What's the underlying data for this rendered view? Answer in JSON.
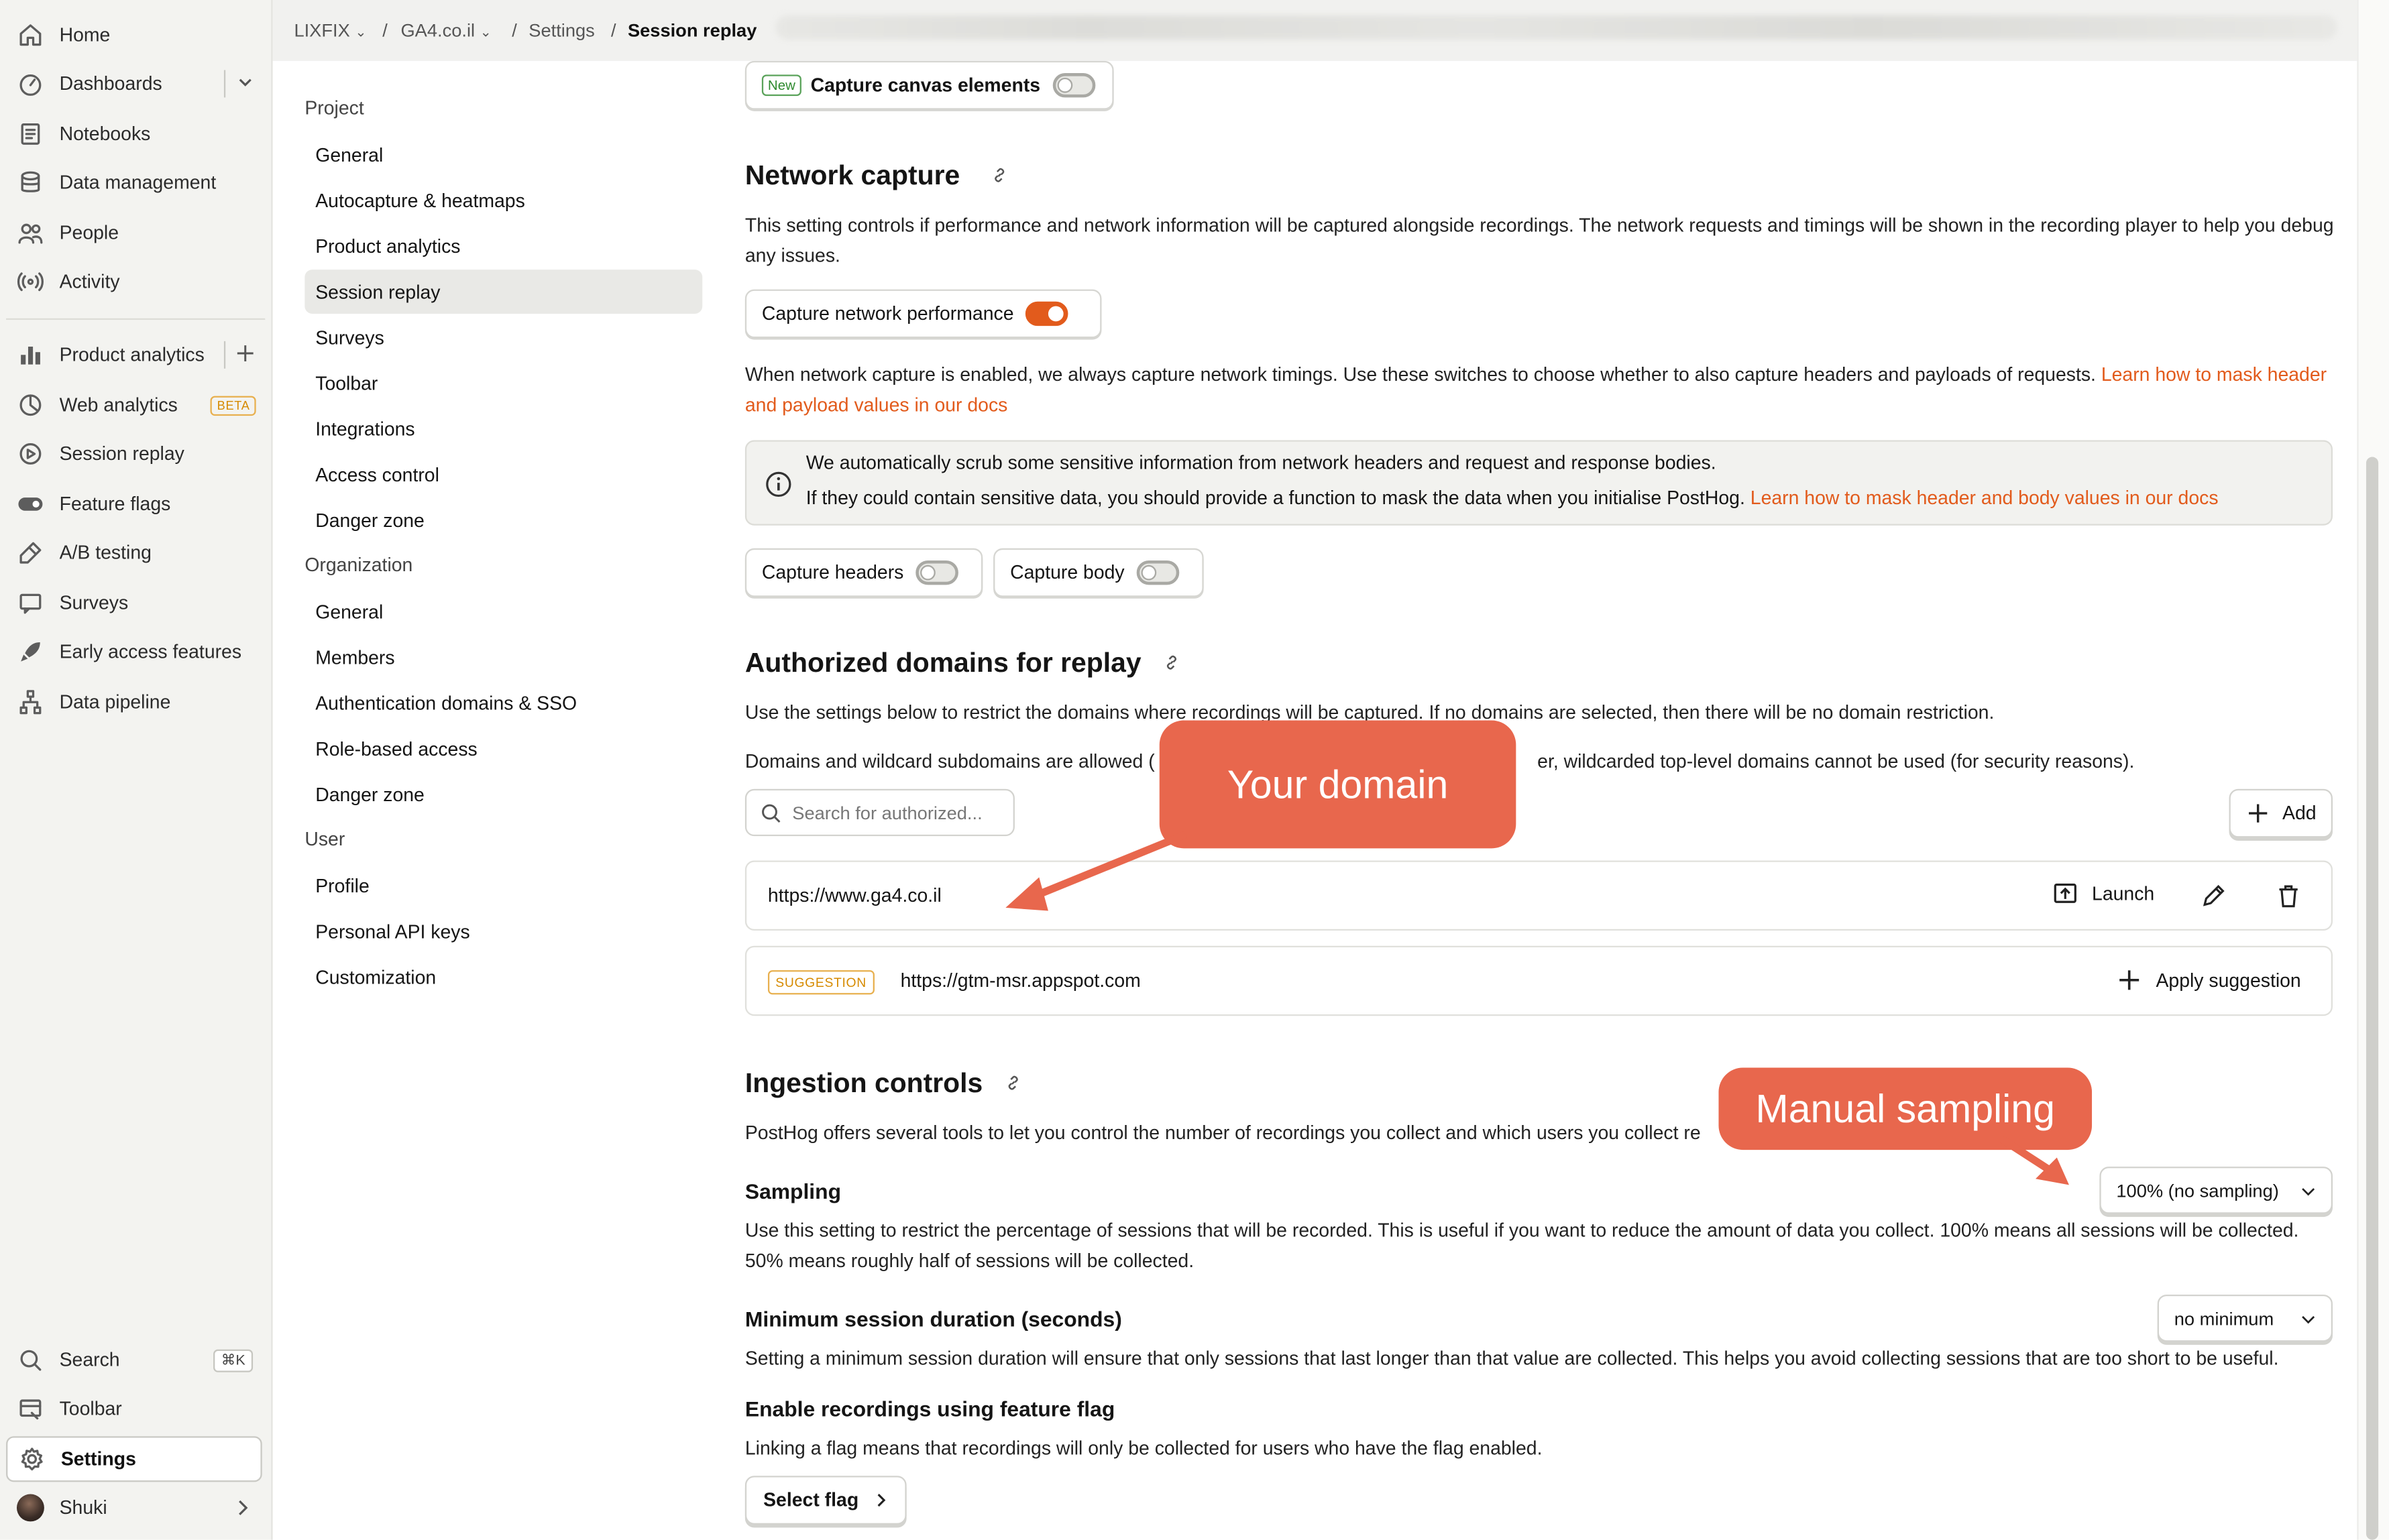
{
  "leftnav": {
    "items": [
      {
        "label": "Home",
        "icon": "home-icon"
      },
      {
        "label": "Dashboards",
        "icon": "dashboard-icon"
      },
      {
        "label": "Notebooks",
        "icon": "notebook-icon"
      },
      {
        "label": "Data management",
        "icon": "database-icon"
      },
      {
        "label": "People",
        "icon": "people-icon"
      },
      {
        "label": "Activity",
        "icon": "activity-icon"
      },
      {
        "label": "Product analytics",
        "icon": "bar-chart-icon"
      },
      {
        "label": "Web analytics",
        "icon": "web-analytics-icon",
        "badge": "BETA"
      },
      {
        "label": "Session replay",
        "icon": "play-icon"
      },
      {
        "label": "Feature flags",
        "icon": "toggle-icon"
      },
      {
        "label": "A/B testing",
        "icon": "flask-icon"
      },
      {
        "label": "Surveys",
        "icon": "survey-icon"
      },
      {
        "label": "Early access features",
        "icon": "rocket-icon"
      },
      {
        "label": "Data pipeline",
        "icon": "pipeline-icon"
      }
    ],
    "bottom": {
      "search": {
        "label": "Search",
        "shortcut": "⌘K"
      },
      "toolbar": {
        "label": "Toolbar"
      },
      "settings": {
        "label": "Settings"
      },
      "user": {
        "label": "Shuki"
      }
    }
  },
  "breadcrumb": {
    "org": "LIXFIX",
    "project": "GA4.co.il",
    "section": "Settings",
    "current": "Session replay"
  },
  "settings_nav": {
    "project_heading": "Project",
    "project_items": [
      "General",
      "Autocapture & heatmaps",
      "Product analytics",
      "Session replay",
      "Surveys",
      "Toolbar",
      "Integrations",
      "Access control",
      "Danger zone"
    ],
    "organization_heading": "Organization",
    "organization_items": [
      "General",
      "Members",
      "Authentication domains & SSO",
      "Role-based access",
      "Danger zone"
    ],
    "user_heading": "User",
    "user_items": [
      "Profile",
      "Personal API keys",
      "Customization"
    ]
  },
  "canvas_card": {
    "badge": "New",
    "label": "Capture canvas elements",
    "enabled": false
  },
  "network": {
    "title": "Network capture",
    "description": "This setting controls if performance and network information will be captured alongside recordings. The network requests and timings will be shown in the recording player to help you debug any issues.",
    "performance_toggle": {
      "label": "Capture network performance",
      "enabled": true
    },
    "timings_text": "When network capture is enabled, we always capture network timings. Use these switches to choose whether to also capture headers and payloads of requests.",
    "timings_link": "Learn how to mask header and payload values in our docs",
    "info_line1": "We automatically scrub some sensitive information from network headers and request and response bodies.",
    "info_line2": "If they could contain sensitive data, you should provide a function to mask the data when you initialise PostHog.",
    "info_link": "Learn how to mask header and body values in our docs",
    "headers_toggle": {
      "label": "Capture headers",
      "enabled": false
    },
    "body_toggle": {
      "label": "Capture body",
      "enabled": false
    }
  },
  "domains": {
    "title": "Authorized domains for replay",
    "description": "Use the settings below to restrict the domains where recordings will be captured. If no domains are selected, then there will be no domain restriction.",
    "wildcard_left": "Domains and wildcard subdomains are allowed (",
    "wildcard_right": "er, wildcarded top-level domains cannot be used (for security reasons).",
    "search_placeholder": "Search for authorized...",
    "add_label": "Add",
    "domain": "https://www.ga4.co.il",
    "launch_label": "Launch",
    "suggestion_badge": "SUGGESTION",
    "suggestion_domain": "https://gtm-msr.appspot.com",
    "apply_label": "Apply suggestion"
  },
  "ingestion": {
    "title": "Ingestion controls",
    "description": "PostHog offers several tools to let you control the number of recordings you collect and which users you collect re",
    "sampling_title": "Sampling",
    "sampling_value": "100% (no sampling)",
    "sampling_desc": "Use this setting to restrict the percentage of sessions that will be recorded. This is useful if you want to reduce the amount of data you collect. 100% means all sessions will be collected. 50% means roughly half of sessions will be collected.",
    "min_duration_title": "Minimum session duration (seconds)",
    "min_duration_value": "no minimum",
    "min_duration_desc": "Setting a minimum session duration will ensure that only sessions that last longer than that value are collected. This helps you avoid collecting sessions that are too short to be useful.",
    "flag_title": "Enable recordings using feature flag",
    "flag_desc": "Linking a flag means that recordings will only be collected for users who have the flag enabled.",
    "select_flag_label": "Select flag"
  },
  "annotations": {
    "your_domain": "Your domain",
    "manual_sampling": "Manual sampling",
    "color": "#e8674d"
  },
  "colors": {
    "accent": "#e25b1c",
    "sidebar_bg": "#f3f3f0"
  }
}
